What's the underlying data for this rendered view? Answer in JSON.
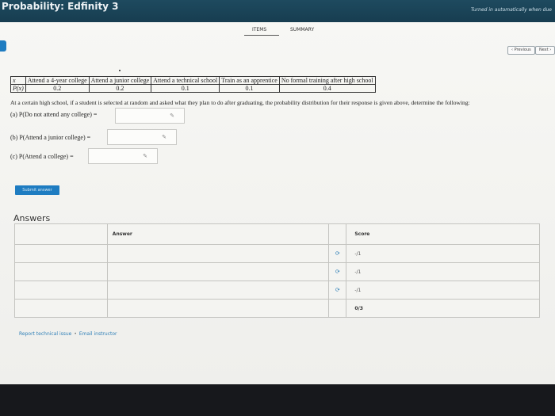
{
  "app": {
    "title": "Probability: Edfinity 3",
    "status": "Turned in automatically when due"
  },
  "tabs": [
    {
      "label": "ITEMS",
      "active": true
    },
    {
      "label": "SUMMARY",
      "active": false
    }
  ],
  "nav": {
    "previous_label": "‹ Previous",
    "next_label": "Next ›"
  },
  "distribution_table": {
    "header_row_label": "x",
    "columns": [
      "Attend a 4-year college",
      "Attend a junior college",
      "Attend a technical school",
      "Train as an apprentice",
      "No formal training after high school"
    ],
    "prob_row_label": "P(x)",
    "probabilities": [
      "0.2",
      "0.2",
      "0.1",
      "0.1",
      "0.4"
    ]
  },
  "question": {
    "text": "At a certain high school, if a student is selected at random and asked what they plan to do after graduating, the probability distribution for their response is given above, determine the following:",
    "parts": [
      {
        "label": "(a) P(Do not attend any college) =",
        "value": ""
      },
      {
        "label": "(b) P(Attend a junior college) =",
        "value": ""
      },
      {
        "label": "(c) P(Attend a college) =",
        "value": ""
      }
    ]
  },
  "submit_label": "Submit answer",
  "answers": {
    "heading": "Answers",
    "col_answer": "Answer",
    "col_score": "Score",
    "rows": [
      {
        "answer": "",
        "score": "-/1"
      },
      {
        "answer": "",
        "score": "-/1"
      },
      {
        "answer": "",
        "score": "-/1"
      }
    ],
    "total": "0/3"
  },
  "footer": {
    "report_label": "Report technical issue",
    "separator": "•",
    "email_label": "Email instructor"
  },
  "colors": {
    "topbar": "#1e4a5f",
    "accent": "#1e7cc1",
    "link": "#2f7fb7"
  }
}
